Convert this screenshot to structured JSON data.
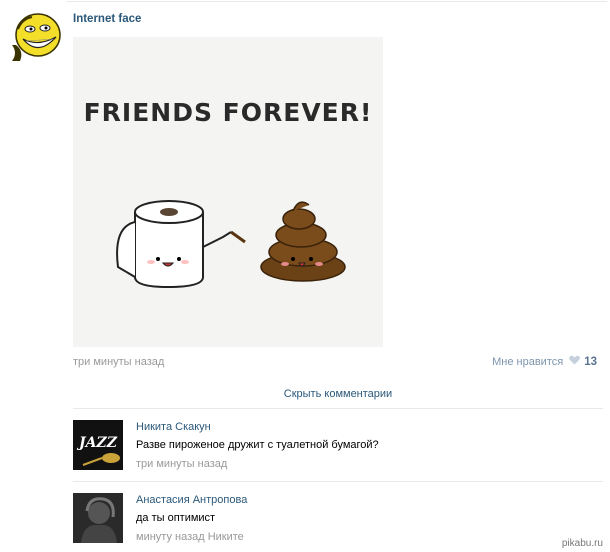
{
  "post": {
    "author": "Internet face",
    "image_caption_text": "FRIENDS FOREVER!",
    "time": "три минуты назад",
    "like_label": "Мне нравится",
    "like_count": "13",
    "hide_comments": "Скрыть комментарии"
  },
  "comments": [
    {
      "author": "Никита Скакун",
      "text": "Разве пироженое дружит с туалетной бумагой?",
      "meta": "три минуты назад",
      "avatar_text": "JAZZ"
    },
    {
      "author": "Анастасия Антропова",
      "text": "да ты оптимист",
      "meta": "минуту назад Никите"
    }
  ],
  "watermark": "pikabu.ru",
  "colors": {
    "link": "#2b587a",
    "muted": "#999999",
    "like_heart": "#c5d0dc",
    "divider": "#e7eaed"
  }
}
